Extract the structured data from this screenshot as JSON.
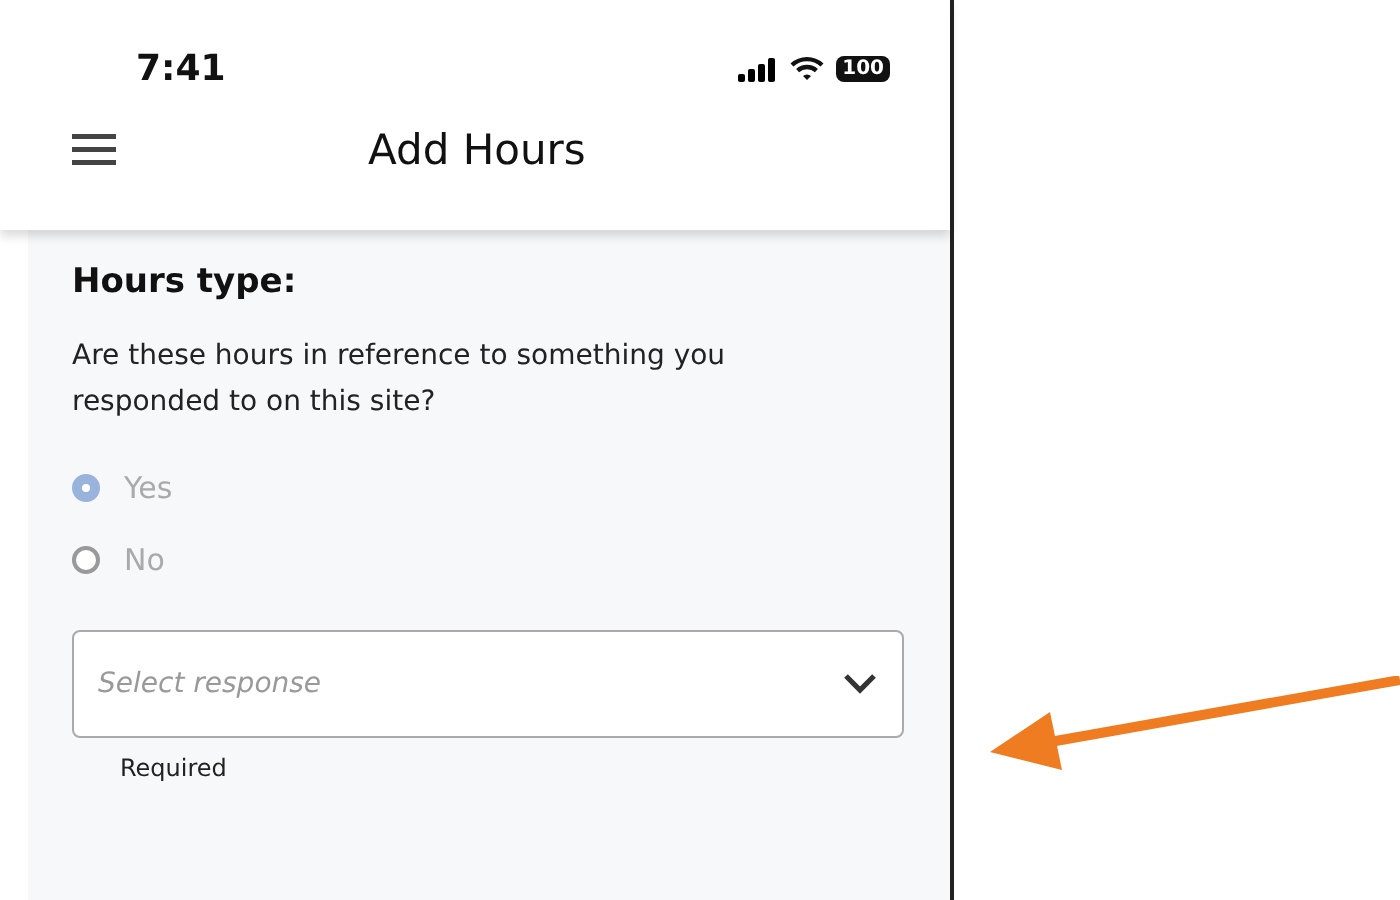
{
  "status_bar": {
    "time": "7:41",
    "battery": "100"
  },
  "header": {
    "title": "Add Hours"
  },
  "form": {
    "heading": "Hours type:",
    "question": "Are these hours in reference to something you responded to on this site?",
    "options": [
      {
        "label": "Yes",
        "selected": true,
        "disabled": true
      },
      {
        "label": "No",
        "selected": false,
        "disabled": true
      }
    ],
    "dropdown": {
      "placeholder": "Select response",
      "hint": "Required"
    }
  },
  "annotation": {
    "kind": "arrow"
  }
}
